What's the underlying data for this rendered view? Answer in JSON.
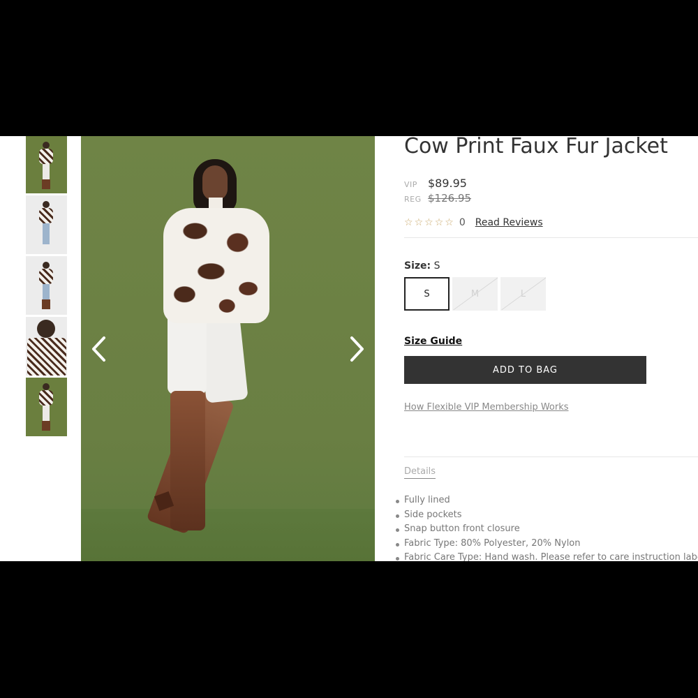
{
  "product": {
    "title": "Cow Print Faux Fur Jacket",
    "vip_label": "VIP",
    "vip_price": "$89.95",
    "reg_label": "REG",
    "reg_price": "$126.95",
    "rating_stars": 0,
    "rating_count": "0",
    "read_reviews": "Read Reviews"
  },
  "size": {
    "label": "Size:",
    "selected": "S",
    "options": [
      {
        "label": "S",
        "state": "selected"
      },
      {
        "label": "M",
        "state": "unavailable"
      },
      {
        "label": "L",
        "state": "unavailable"
      }
    ]
  },
  "size_guide": "Size Guide",
  "add_to_bag": "ADD TO BAG",
  "vip_link": "How Flexible VIP Membership Works",
  "details": {
    "tab": "Details",
    "items": [
      "Fully lined",
      "Side pockets",
      "Snap button front closure",
      "Fabric Type: 80% Polyester, 20% Nylon",
      "Fabric Care Type: Hand wash. Please refer to care instruction label"
    ]
  },
  "gallery": {
    "prev_icon": "chevron-left-icon",
    "next_icon": "chevron-right-icon",
    "thumbnails": 5,
    "active_thumbnail": 1
  },
  "colors": {
    "button_bg": "#333333",
    "background_green": "#6b7f3e",
    "star": "#c9a86a"
  }
}
